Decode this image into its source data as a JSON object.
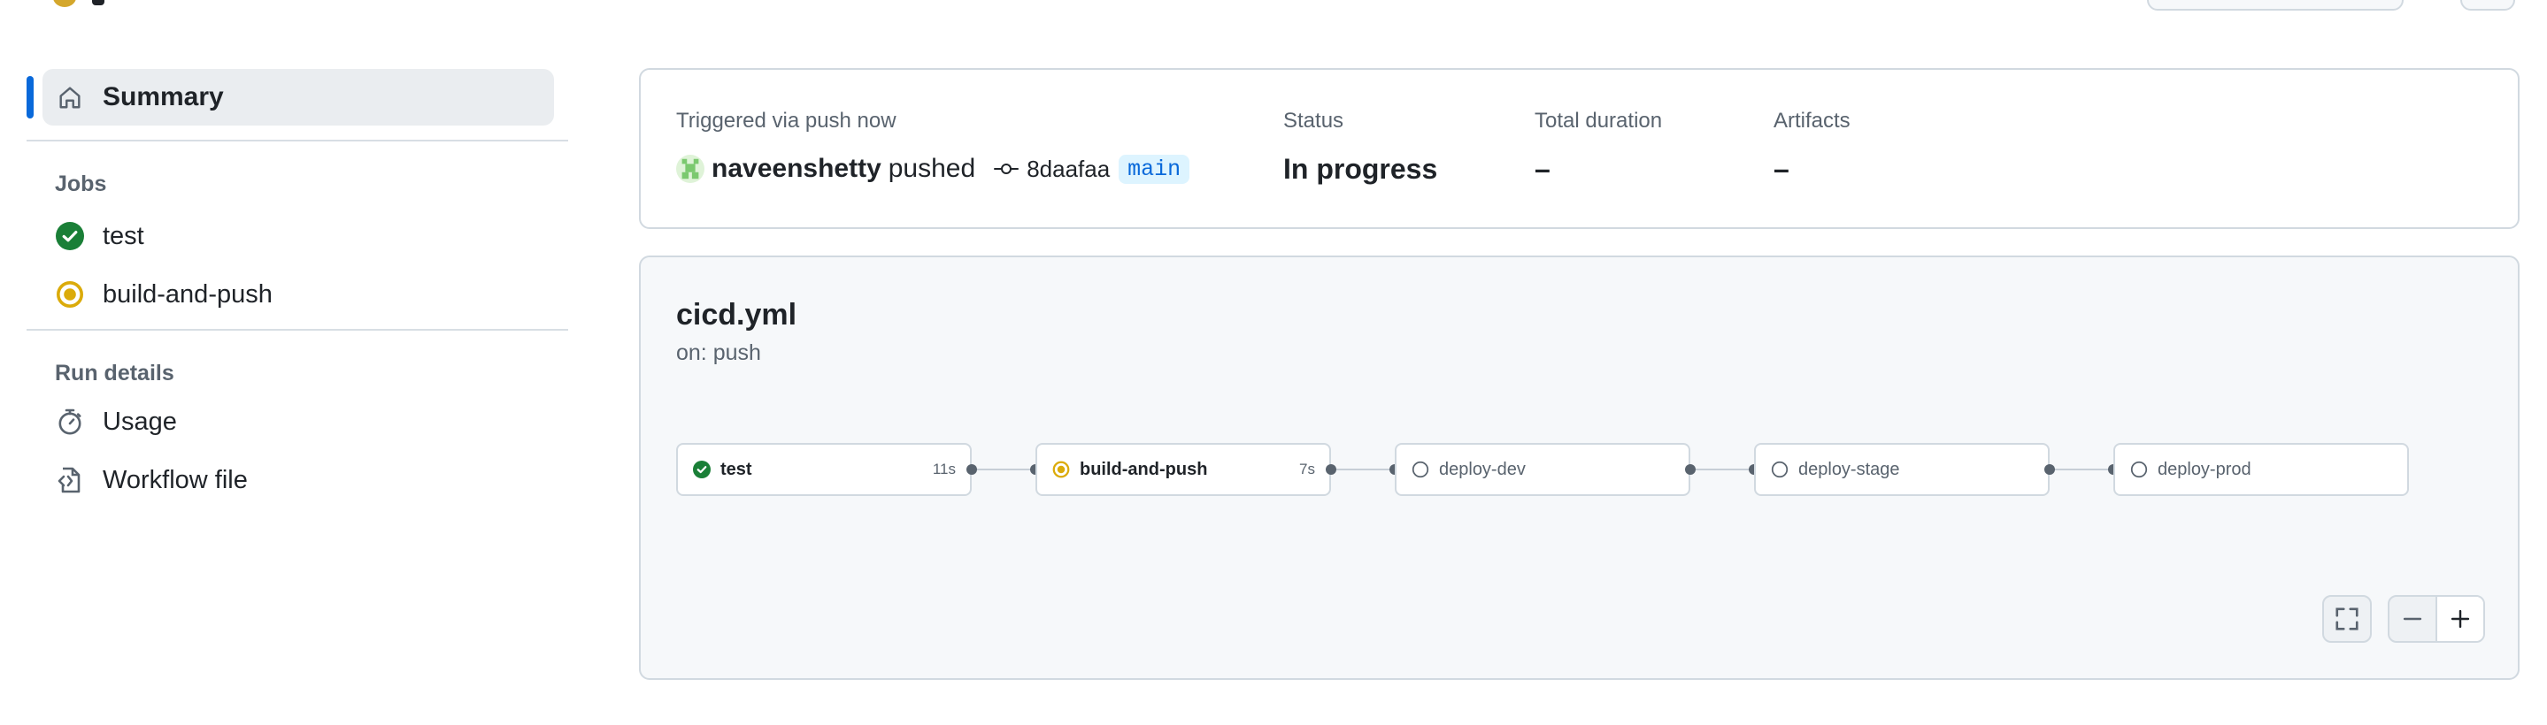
{
  "sidebar": {
    "summary_label": "Summary",
    "jobs_heading": "Jobs",
    "jobs": [
      {
        "label": "test",
        "status": "success"
      },
      {
        "label": "build-and-push",
        "status": "in_progress"
      }
    ],
    "run_details_heading": "Run details",
    "run_details": [
      {
        "label": "Usage",
        "icon": "stopwatch-icon"
      },
      {
        "label": "Workflow file",
        "icon": "file-code-icon"
      }
    ]
  },
  "trigger": {
    "heading": "Triggered via push now",
    "user": "naveenshetty",
    "action": "pushed",
    "commit": "8daafaa",
    "branch": "main",
    "status_heading": "Status",
    "status_value": "In progress",
    "duration_heading": "Total duration",
    "duration_value": "–",
    "artifacts_heading": "Artifacts",
    "artifacts_value": "–"
  },
  "workflow": {
    "file": "cicd.yml",
    "trigger": "on: push",
    "jobs": [
      {
        "name": "test",
        "status": "success",
        "time": "11s"
      },
      {
        "name": "build-and-push",
        "status": "in_progress",
        "time": "7s"
      },
      {
        "name": "deploy-dev",
        "status": "pending",
        "time": ""
      },
      {
        "name": "deploy-stage",
        "status": "pending",
        "time": ""
      },
      {
        "name": "deploy-prod",
        "status": "pending",
        "time": ""
      }
    ]
  },
  "colors": {
    "accent": "#0969da",
    "success": "#1a7f37",
    "in_progress": "#dbab0a",
    "border": "#d1d9e0"
  }
}
